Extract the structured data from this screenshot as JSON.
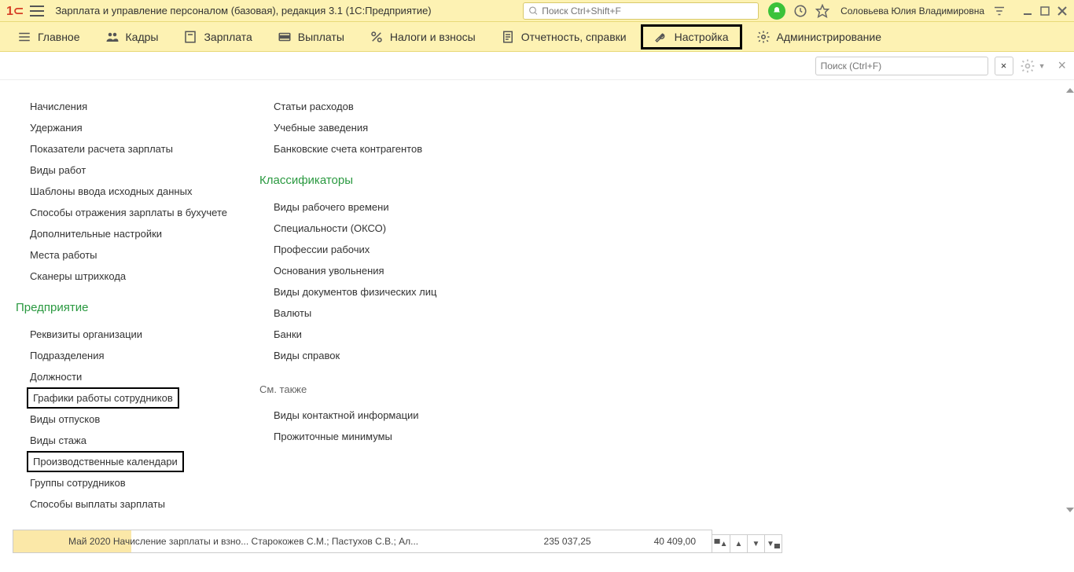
{
  "titlebar": {
    "app_title": "Зарплата и управление персоналом (базовая), редакция 3.1  (1С:Предприятие)",
    "search_placeholder": "Поиск Ctrl+Shift+F",
    "username": "Соловьева Юлия Владимировна"
  },
  "nav": {
    "main": "Главное",
    "hr": "Кадры",
    "salary": "Зарплата",
    "payments": "Выплаты",
    "taxes": "Налоги и взносы",
    "reports": "Отчетность, справки",
    "settings": "Настройка",
    "admin": "Администрирование"
  },
  "content_bar": {
    "search_placeholder": "Поиск (Ctrl+F)"
  },
  "col1_top": [
    "Начисления",
    "Удержания",
    "Показатели расчета зарплаты",
    "Виды работ",
    "Шаблоны ввода исходных данных",
    "Способы отражения зарплаты в бухучете",
    "Дополнительные настройки",
    "Места работы",
    "Сканеры штрихкода"
  ],
  "col1_section": "Предприятие",
  "col1_bottom": [
    {
      "t": "Реквизиты организации",
      "boxed": false
    },
    {
      "t": "Подразделения",
      "boxed": false
    },
    {
      "t": "Должности",
      "boxed": false
    },
    {
      "t": "Графики работы сотрудников",
      "boxed": true
    },
    {
      "t": "Виды отпусков",
      "boxed": false
    },
    {
      "t": "Виды стажа",
      "boxed": false
    },
    {
      "t": "Производственные календари",
      "boxed": true
    },
    {
      "t": "Группы сотрудников",
      "boxed": false
    },
    {
      "t": "Способы выплаты зарплаты",
      "boxed": false
    }
  ],
  "col2_top": [
    "Статьи расходов",
    "Учебные заведения",
    "Банковские счета контрагентов"
  ],
  "col2_section": "Классификаторы",
  "col2_mid": [
    "Виды рабочего времени",
    "Специальности (ОКСО)",
    "Профессии рабочих",
    "Основания увольнения",
    "Виды документов физических лиц",
    "Валюты",
    "Банки",
    "Виды справок"
  ],
  "col2_seealso": "См. также",
  "col2_bottom": [
    "Виды контактной информации",
    "Прожиточные минимумы"
  ],
  "footer": {
    "text": "Май 2020     Начисление зарплаты и взно...    Старокожев С.М.; Пастухов С.В.; Ал...",
    "num1": "235 037,25",
    "num2": "40 409,00"
  }
}
